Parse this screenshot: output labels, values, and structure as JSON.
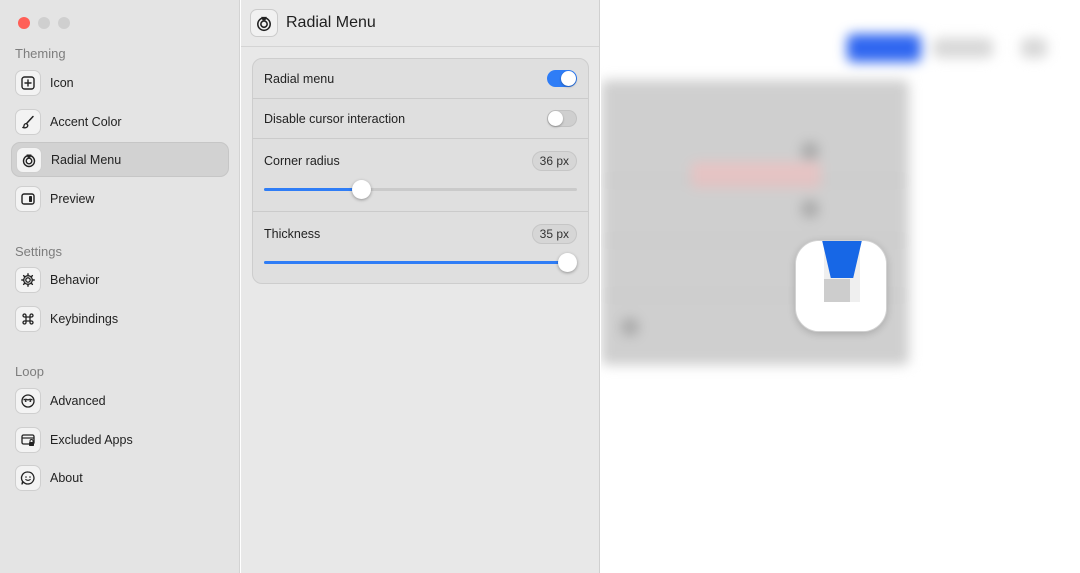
{
  "sidebar": {
    "sections": [
      {
        "title": "Theming",
        "items": [
          {
            "label": "Icon",
            "icon": "plus-square-icon"
          },
          {
            "label": "Accent Color",
            "icon": "paintbrush-icon"
          },
          {
            "label": "Radial Menu",
            "icon": "radial-menu-icon",
            "active": true
          },
          {
            "label": "Preview",
            "icon": "sidebar-right-icon"
          }
        ]
      },
      {
        "title": "Settings",
        "items": [
          {
            "label": "Behavior",
            "icon": "gear-icon"
          },
          {
            "label": "Keybindings",
            "icon": "command-icon"
          }
        ]
      },
      {
        "title": "Loop",
        "items": [
          {
            "label": "Advanced",
            "icon": "face-mask-icon"
          },
          {
            "label": "Excluded Apps",
            "icon": "window-lock-icon"
          },
          {
            "label": "About",
            "icon": "smiley-bubble-icon"
          }
        ]
      }
    ]
  },
  "header": {
    "title": "Radial Menu",
    "icon": "radial-menu-icon"
  },
  "settings": {
    "radial_menu": {
      "label": "Radial menu",
      "enabled": true
    },
    "disable_cursor": {
      "label": "Disable cursor interaction",
      "enabled": false
    },
    "corner_radius": {
      "label": "Corner radius",
      "value_text": "36 px",
      "fraction": 0.31
    },
    "thickness": {
      "label": "Thickness",
      "value_text": "35 px",
      "fraction": 1.0
    }
  },
  "colors": {
    "accent": "#2f7df6",
    "radial_highlight": "#1767e6"
  }
}
